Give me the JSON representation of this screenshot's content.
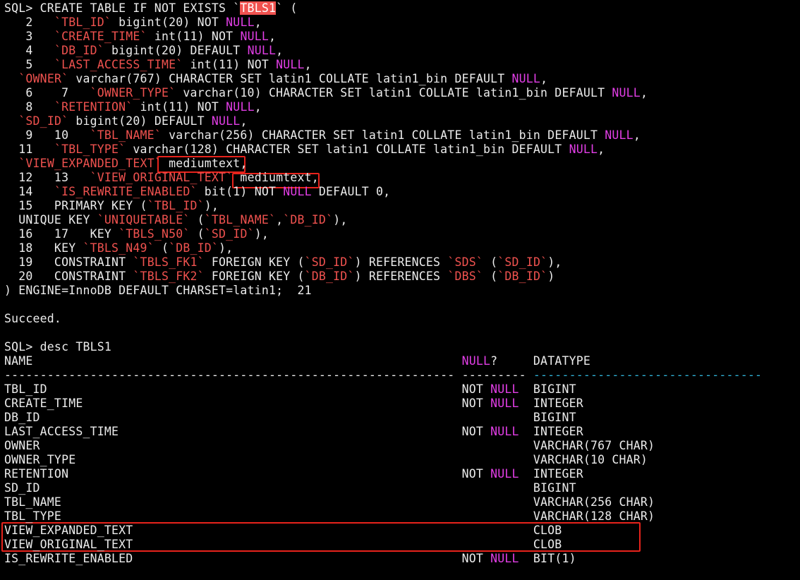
{
  "colors": {
    "background": "#000000",
    "text": "#ececec",
    "identifier": "#f0524f",
    "keyword_null": "#e23ee6",
    "highlight_bg": "#f0524f",
    "table_divider_cyan": "#2fb1d6",
    "annotation_box": "#e8231c"
  },
  "lines": [
    [
      {
        "t": "SQL> CREATE TABLE IF NOT EXISTS `",
        "c": "white"
      },
      {
        "t": "TBLS1",
        "c": "hl"
      },
      {
        "t": "` (",
        "c": "white"
      }
    ],
    [
      {
        "t": "   2   ",
        "c": "white"
      },
      {
        "t": "`TBL_ID`",
        "c": "red"
      },
      {
        "t": " bigint(20) NOT ",
        "c": "white"
      },
      {
        "t": "NULL",
        "c": "mag"
      },
      {
        "t": ",",
        "c": "white"
      }
    ],
    [
      {
        "t": "   3   ",
        "c": "white"
      },
      {
        "t": "`CREATE_TIME`",
        "c": "red"
      },
      {
        "t": " int(11) NOT ",
        "c": "white"
      },
      {
        "t": "NULL",
        "c": "mag"
      },
      {
        "t": ",",
        "c": "white"
      }
    ],
    [
      {
        "t": "   4   ",
        "c": "white"
      },
      {
        "t": "`DB_ID`",
        "c": "red"
      },
      {
        "t": " bigint(20) DEFAULT ",
        "c": "white"
      },
      {
        "t": "NULL",
        "c": "mag"
      },
      {
        "t": ",",
        "c": "white"
      }
    ],
    [
      {
        "t": "   5   ",
        "c": "white"
      },
      {
        "t": "`LAST_ACCESS_TIME`",
        "c": "red"
      },
      {
        "t": " int(11) NOT ",
        "c": "white"
      },
      {
        "t": "NULL",
        "c": "mag"
      },
      {
        "t": ",",
        "c": "white"
      }
    ],
    [
      {
        "t": "  ",
        "c": "white"
      },
      {
        "t": "`OWNER`",
        "c": "red"
      },
      {
        "t": " varchar(767) CHARACTER SET latin1 COLLATE latin1_bin DEFAULT ",
        "c": "white"
      },
      {
        "t": "NULL",
        "c": "mag"
      },
      {
        "t": ",",
        "c": "white"
      }
    ],
    [
      {
        "t": "   6    7   ",
        "c": "white"
      },
      {
        "t": "`OWNER_TYPE`",
        "c": "red"
      },
      {
        "t": " varchar(10) CHARACTER SET latin1 COLLATE latin1_bin DEFAULT ",
        "c": "white"
      },
      {
        "t": "NULL",
        "c": "mag"
      },
      {
        "t": ",",
        "c": "white"
      }
    ],
    [
      {
        "t": "   8   ",
        "c": "white"
      },
      {
        "t": "`RETENTION`",
        "c": "red"
      },
      {
        "t": " int(11) NOT ",
        "c": "white"
      },
      {
        "t": "NULL",
        "c": "mag"
      },
      {
        "t": ",",
        "c": "white"
      }
    ],
    [
      {
        "t": "  ",
        "c": "white"
      },
      {
        "t": "`SD_ID`",
        "c": "red"
      },
      {
        "t": " bigint(20) DEFAULT ",
        "c": "white"
      },
      {
        "t": "NULL",
        "c": "mag"
      },
      {
        "t": ",",
        "c": "white"
      }
    ],
    [
      {
        "t": "   9   10   ",
        "c": "white"
      },
      {
        "t": "`TBL_NAME`",
        "c": "red"
      },
      {
        "t": " varchar(256) CHARACTER SET latin1 COLLATE latin1_bin DEFAULT ",
        "c": "white"
      },
      {
        "t": "NULL",
        "c": "mag"
      },
      {
        "t": ",",
        "c": "white"
      }
    ],
    [
      {
        "t": "  11   ",
        "c": "white"
      },
      {
        "t": "`TBL_TYPE`",
        "c": "red"
      },
      {
        "t": " varchar(128) CHARACTER SET latin1 COLLATE latin1_bin DEFAULT ",
        "c": "white"
      },
      {
        "t": "NULL",
        "c": "mag"
      },
      {
        "t": ",",
        "c": "white"
      }
    ],
    [
      {
        "t": "  ",
        "c": "white"
      },
      {
        "t": "`VIEW_EXPANDED_TEXT`",
        "c": "red"
      },
      {
        "t": " mediumtext,",
        "c": "white"
      }
    ],
    [
      {
        "t": "  12   13   ",
        "c": "white"
      },
      {
        "t": "`VIEW_ORIGINAL_TEXT`",
        "c": "red"
      },
      {
        "t": " mediumtext,",
        "c": "white"
      }
    ],
    [
      {
        "t": "  14   ",
        "c": "white"
      },
      {
        "t": "`IS_REWRITE_ENABLED`",
        "c": "red"
      },
      {
        "t": " bit(1) NOT ",
        "c": "white"
      },
      {
        "t": "NULL",
        "c": "mag"
      },
      {
        "t": " DEFAULT 0,",
        "c": "white"
      }
    ],
    [
      {
        "t": "  15   PRIMARY KEY (",
        "c": "white"
      },
      {
        "t": "`TBL_ID`",
        "c": "red"
      },
      {
        "t": "),",
        "c": "white"
      }
    ],
    [
      {
        "t": "  UNIQUE KEY ",
        "c": "white"
      },
      {
        "t": "`UNIQUETABLE`",
        "c": "red"
      },
      {
        "t": " (",
        "c": "white"
      },
      {
        "t": "`TBL_NAME`",
        "c": "red"
      },
      {
        "t": ",",
        "c": "white"
      },
      {
        "t": "`DB_ID`",
        "c": "red"
      },
      {
        "t": "),",
        "c": "white"
      }
    ],
    [
      {
        "t": "  16   17   KEY ",
        "c": "white"
      },
      {
        "t": "`TBLS_N50`",
        "c": "red"
      },
      {
        "t": " (",
        "c": "white"
      },
      {
        "t": "`SD_ID`",
        "c": "red"
      },
      {
        "t": "),",
        "c": "white"
      }
    ],
    [
      {
        "t": "  18   KEY ",
        "c": "white"
      },
      {
        "t": "`TBLS_N49`",
        "c": "red"
      },
      {
        "t": " (",
        "c": "white"
      },
      {
        "t": "`DB_ID`",
        "c": "red"
      },
      {
        "t": "),",
        "c": "white"
      }
    ],
    [
      {
        "t": "  19   CONSTRAINT ",
        "c": "white"
      },
      {
        "t": "`TBLS_FK1`",
        "c": "red"
      },
      {
        "t": " FOREIGN KEY (",
        "c": "white"
      },
      {
        "t": "`SD_ID`",
        "c": "red"
      },
      {
        "t": ") REFERENCES ",
        "c": "white"
      },
      {
        "t": "`SDS`",
        "c": "red"
      },
      {
        "t": " (",
        "c": "white"
      },
      {
        "t": "`SD_ID`",
        "c": "red"
      },
      {
        "t": "),",
        "c": "white"
      }
    ],
    [
      {
        "t": "  20   CONSTRAINT ",
        "c": "white"
      },
      {
        "t": "`TBLS_FK2`",
        "c": "red"
      },
      {
        "t": " FOREIGN KEY (",
        "c": "white"
      },
      {
        "t": "`DB_ID`",
        "c": "red"
      },
      {
        "t": ") REFERENCES ",
        "c": "white"
      },
      {
        "t": "`DBS`",
        "c": "red"
      },
      {
        "t": " (",
        "c": "white"
      },
      {
        "t": "`DB_ID`",
        "c": "red"
      },
      {
        "t": ")",
        "c": "white"
      }
    ],
    [
      {
        "t": ") ENGINE=InnoDB DEFAULT CHARSET=latin1;  21",
        "c": "white"
      }
    ],
    [],
    [
      {
        "t": "Succeed.",
        "c": "white"
      }
    ],
    [],
    [
      {
        "t": "SQL> desc TBLS1",
        "c": "white"
      }
    ],
    [
      {
        "t": "NAME                                                            ",
        "c": "white"
      },
      {
        "t": "NULL",
        "c": "mag"
      },
      {
        "t": "?     DATATYPE",
        "c": "white"
      }
    ],
    [
      {
        "t": "--------------------------------------------------------------- --------- ",
        "c": "white"
      },
      {
        "t": "--------------------------------",
        "c": "cyan"
      }
    ],
    [
      {
        "t": "TBL_ID                                                          NOT ",
        "c": "white"
      },
      {
        "t": "NULL",
        "c": "mag"
      },
      {
        "t": "  BIGINT",
        "c": "white"
      }
    ],
    [
      {
        "t": "CREATE_TIME                                                     NOT ",
        "c": "white"
      },
      {
        "t": "NULL",
        "c": "mag"
      },
      {
        "t": "  INTEGER",
        "c": "white"
      }
    ],
    [
      {
        "t": "DB_ID                                                                     BIGINT",
        "c": "white"
      }
    ],
    [
      {
        "t": "LAST_ACCESS_TIME                                                NOT ",
        "c": "white"
      },
      {
        "t": "NULL",
        "c": "mag"
      },
      {
        "t": "  INTEGER",
        "c": "white"
      }
    ],
    [
      {
        "t": "OWNER                                                                     VARCHAR(767 CHAR)",
        "c": "white"
      }
    ],
    [
      {
        "t": "OWNER_TYPE                                                                VARCHAR(10 CHAR)",
        "c": "white"
      }
    ],
    [
      {
        "t": "RETENTION                                                       NOT ",
        "c": "white"
      },
      {
        "t": "NULL",
        "c": "mag"
      },
      {
        "t": "  INTEGER",
        "c": "white"
      }
    ],
    [
      {
        "t": "SD_ID                                                                     BIGINT",
        "c": "white"
      }
    ],
    [
      {
        "t": "TBL_NAME                                                                  VARCHAR(256 CHAR)",
        "c": "white"
      }
    ],
    [
      {
        "t": "TBL_TYPE                                                                  VARCHAR(128 CHAR)",
        "c": "white"
      }
    ],
    [
      {
        "t": "VIEW_EXPANDED_TEXT                                                        CLOB",
        "c": "white"
      }
    ],
    [
      {
        "t": "VIEW_ORIGINAL_TEXT                                                        CLOB",
        "c": "white"
      }
    ],
    [
      {
        "t": "IS_REWRITE_ENABLED                                              NOT ",
        "c": "white"
      },
      {
        "t": "NULL",
        "c": "mag"
      },
      {
        "t": "  BIT(1)",
        "c": "white"
      }
    ]
  ]
}
